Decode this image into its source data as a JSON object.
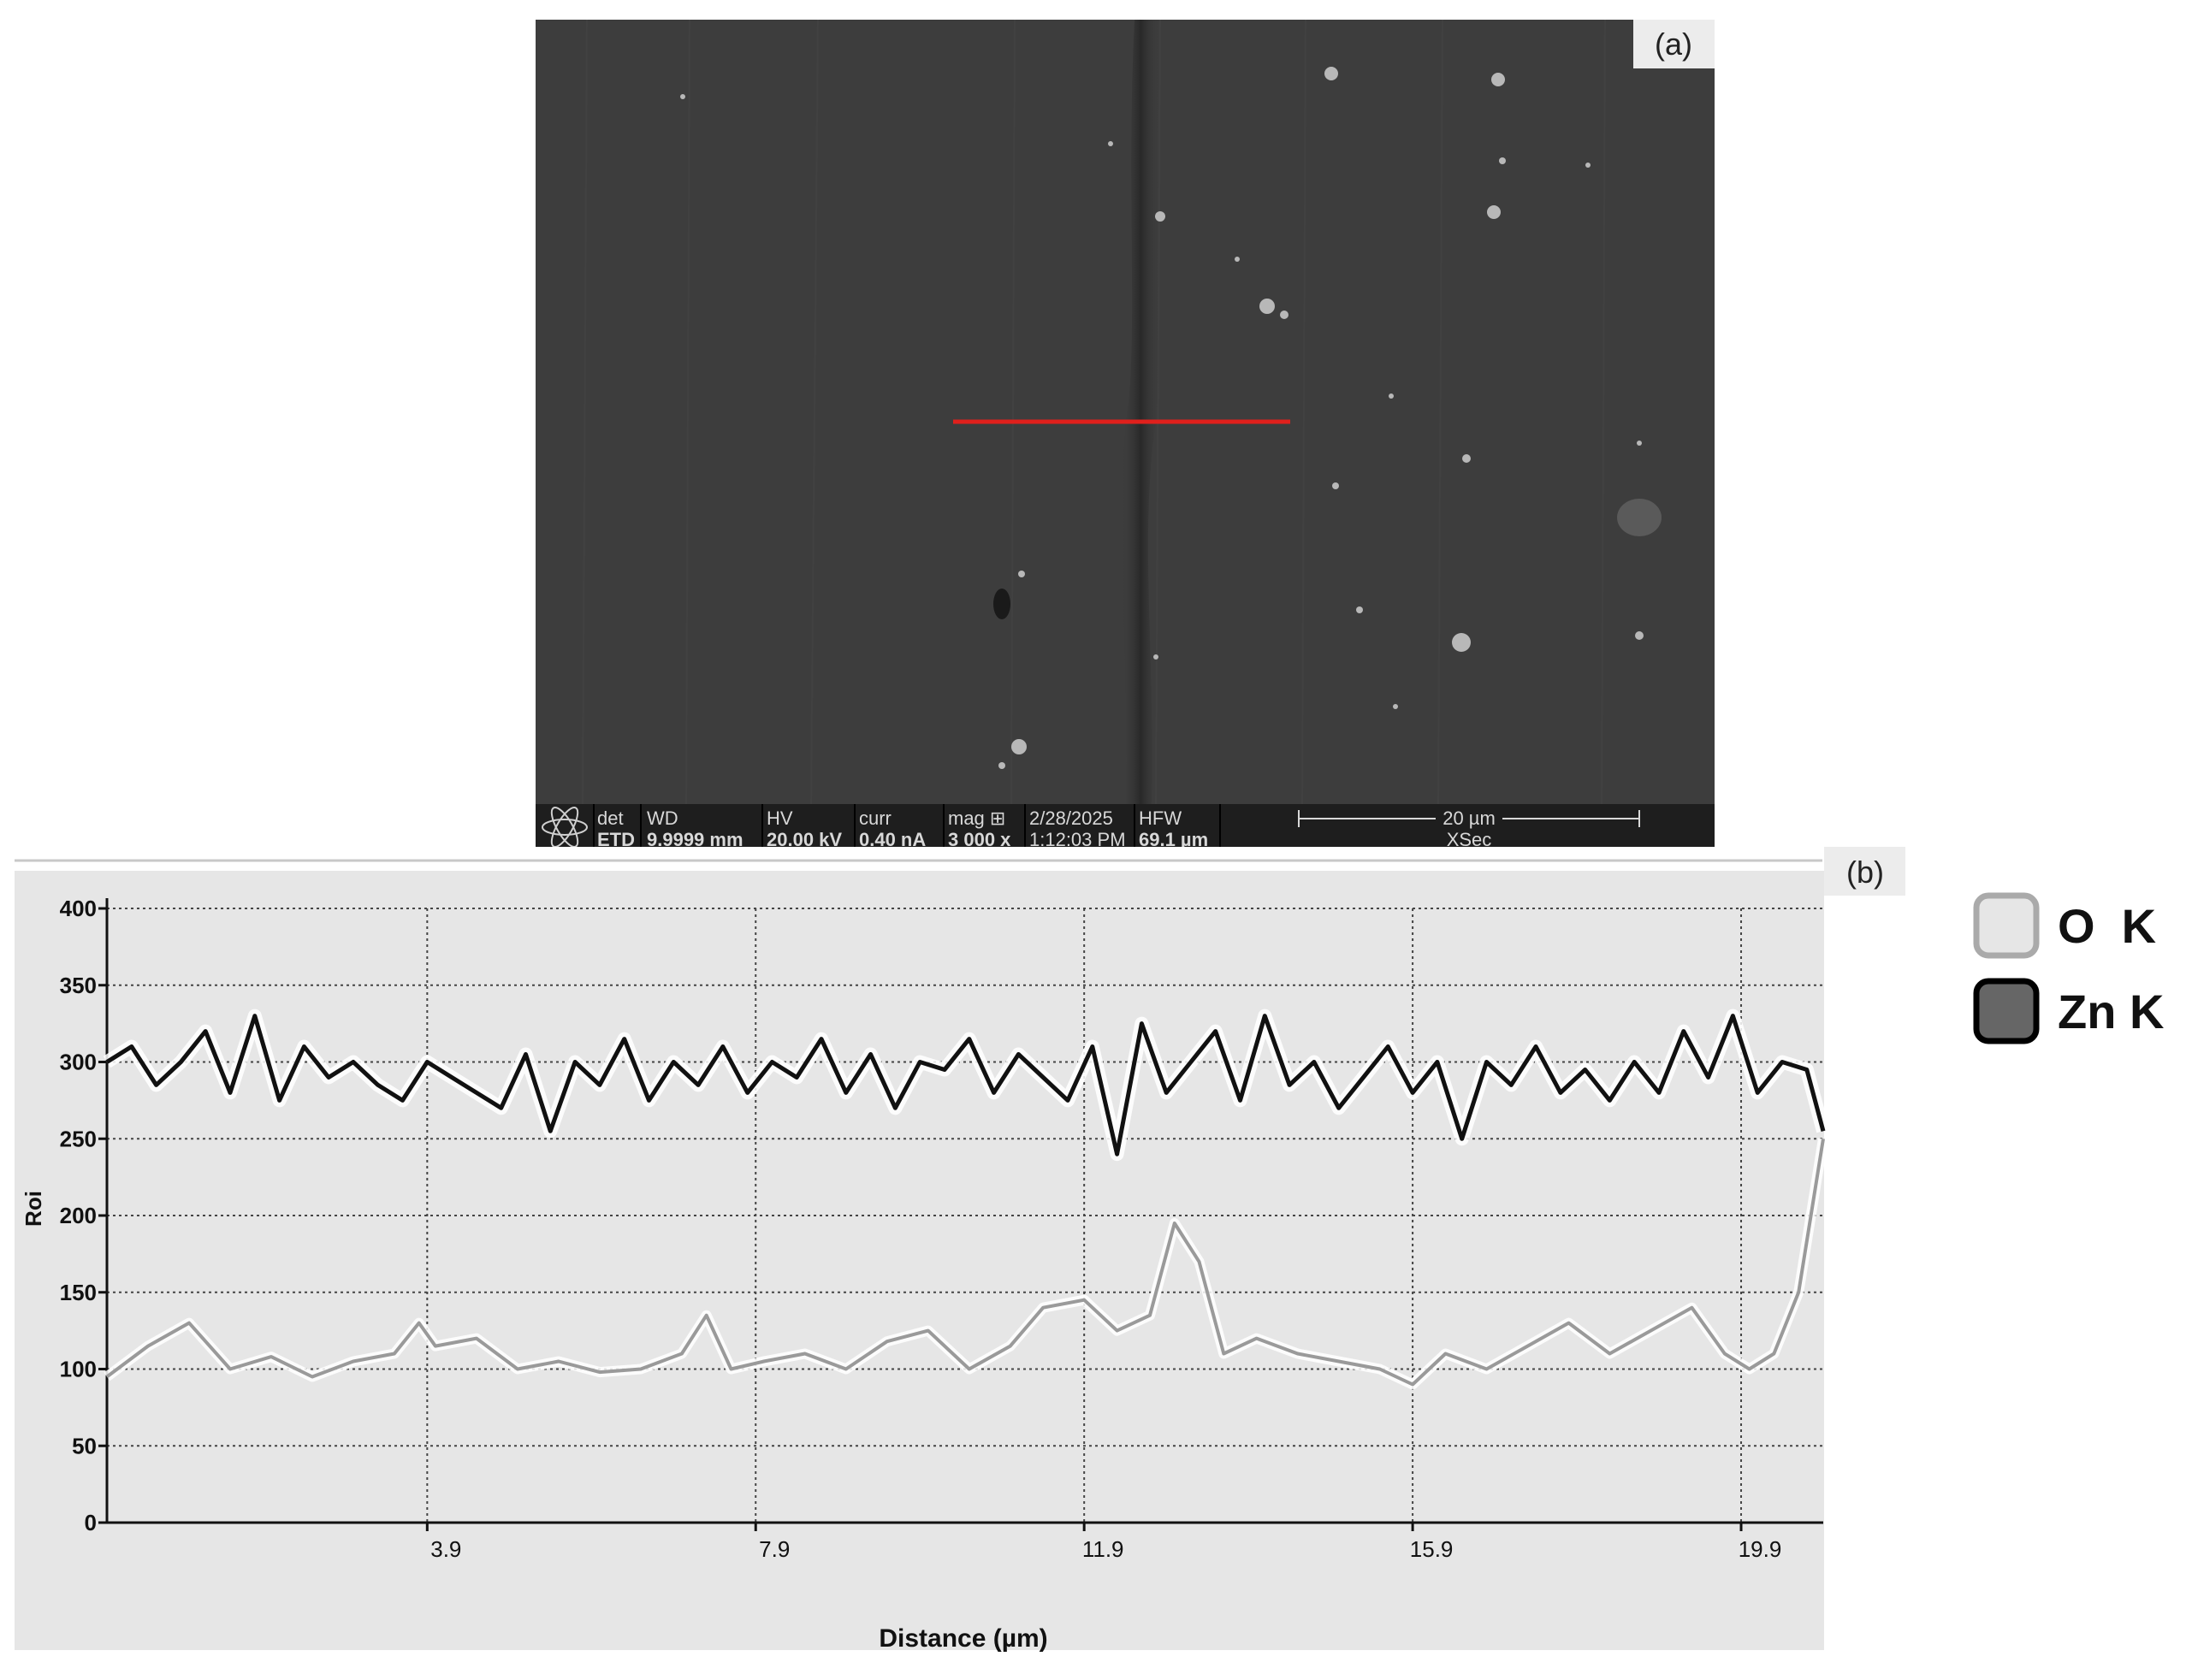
{
  "panel_a": {
    "label": "(a)",
    "databar": {
      "fields": [
        {
          "name": "det",
          "value": "ETD"
        },
        {
          "name": "WD",
          "value": "9.9999 mm"
        },
        {
          "name": "HV",
          "value": "20.00 kV"
        },
        {
          "name": "curr",
          "value": "0.40 nA"
        },
        {
          "name": "mag ⊞",
          "value": "3 000 x"
        },
        {
          "name": "2/28/2025",
          "value": "1:12:03 PM"
        },
        {
          "name": "HFW",
          "value": "69.1 µm"
        }
      ],
      "scale_label": "20 µm",
      "mode_label": "XSec"
    }
  },
  "panel_b": {
    "label": "(b)"
  },
  "colors": {
    "line_marker": "#e0201c",
    "o_k": "#9a9a9a",
    "zn_k": "#111111",
    "sem_bg": "#3d3d3d",
    "plot_bg": "#e6e6e6"
  },
  "chart_data": {
    "type": "line",
    "title": "",
    "xlabel": "Distance (µm)",
    "ylabel": "Roi",
    "xlim": [
      0,
      20.9
    ],
    "ylim": [
      0,
      400
    ],
    "x_ticks": [
      3.9,
      7.9,
      11.9,
      15.9,
      19.9
    ],
    "y_ticks": [
      0,
      50,
      100,
      150,
      200,
      250,
      300,
      350,
      400
    ],
    "grid": true,
    "legend_position": "right, outside plot",
    "series": [
      {
        "name": "O  K",
        "x": [
          0,
          0.5,
          1.0,
          1.5,
          2.0,
          2.5,
          3.0,
          3.5,
          3.8,
          4.0,
          4.5,
          5.0,
          5.5,
          6.0,
          6.5,
          7.0,
          7.3,
          7.6,
          8.0,
          8.5,
          9.0,
          9.5,
          10.0,
          10.5,
          11.0,
          11.4,
          11.9,
          12.3,
          12.7,
          13.0,
          13.3,
          13.6,
          14.0,
          14.5,
          15.0,
          15.5,
          15.9,
          16.3,
          16.8,
          17.3,
          17.8,
          18.3,
          18.8,
          19.3,
          19.7,
          20.0,
          20.3,
          20.6,
          20.9
        ],
        "values": [
          95,
          115,
          130,
          100,
          108,
          95,
          105,
          110,
          130,
          115,
          120,
          100,
          105,
          98,
          100,
          110,
          135,
          100,
          105,
          110,
          100,
          118,
          125,
          100,
          115,
          140,
          145,
          125,
          135,
          195,
          170,
          110,
          120,
          110,
          105,
          100,
          90,
          110,
          100,
          115,
          130,
          110,
          125,
          140,
          110,
          100,
          110,
          150,
          250
        ]
      },
      {
        "name": "Zn K",
        "x": [
          0,
          0.3,
          0.6,
          0.9,
          1.2,
          1.5,
          1.8,
          2.1,
          2.4,
          2.7,
          3.0,
          3.3,
          3.6,
          3.9,
          4.2,
          4.5,
          4.8,
          5.1,
          5.4,
          5.7,
          6.0,
          6.3,
          6.6,
          6.9,
          7.2,
          7.5,
          7.8,
          8.1,
          8.4,
          8.7,
          9.0,
          9.3,
          9.6,
          9.9,
          10.2,
          10.5,
          10.8,
          11.1,
          11.4,
          11.7,
          12.0,
          12.3,
          12.6,
          12.9,
          13.2,
          13.5,
          13.8,
          14.1,
          14.4,
          14.7,
          15.0,
          15.3,
          15.6,
          15.9,
          16.2,
          16.5,
          16.8,
          17.1,
          17.4,
          17.7,
          18.0,
          18.3,
          18.6,
          18.9,
          19.2,
          19.5,
          19.8,
          20.1,
          20.4,
          20.7,
          20.9
        ],
        "values": [
          300,
          310,
          285,
          300,
          320,
          280,
          330,
          275,
          310,
          290,
          300,
          285,
          275,
          300,
          290,
          280,
          270,
          305,
          255,
          300,
          285,
          315,
          275,
          300,
          285,
          310,
          280,
          300,
          290,
          315,
          280,
          305,
          270,
          300,
          295,
          315,
          280,
          305,
          290,
          275,
          310,
          240,
          325,
          280,
          300,
          320,
          275,
          330,
          285,
          300,
          270,
          290,
          310,
          280,
          300,
          250,
          300,
          285,
          310,
          280,
          295,
          275,
          300,
          280,
          320,
          290,
          330,
          280,
          300,
          295,
          255
        ]
      }
    ]
  }
}
